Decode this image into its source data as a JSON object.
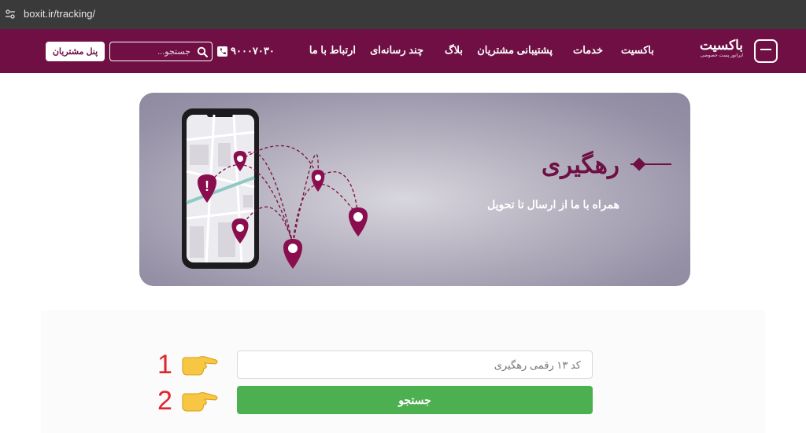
{
  "browser": {
    "url": "boxit.ir/tracking/"
  },
  "header": {
    "brand_name": "باکسیت",
    "brand_tagline": "اپراتور پست خصوصی",
    "menu": [
      "باکسیت",
      "خدمات",
      "پشتیبانی مشتریان",
      "بلاگ",
      "چند رسانه‌ای",
      "ارتباط با ما"
    ],
    "phone": "۹۰۰۰۷۰۳۰",
    "search_placeholder": "جستجو...",
    "panel_label": "پنل مشتریان"
  },
  "hero": {
    "title": "رهگیری",
    "subtitle": "همراه با ما از ارسال تا تحویل"
  },
  "form": {
    "tracking_placeholder": "کد ۱۳ رقمی رهگیری",
    "tracking_value": "",
    "submit_label": "جستجو"
  },
  "annotations": [
    "1",
    "2"
  ],
  "colors": {
    "brand": "#6f0f43",
    "submit": "#4caf50",
    "annotation": "#e0242c"
  }
}
